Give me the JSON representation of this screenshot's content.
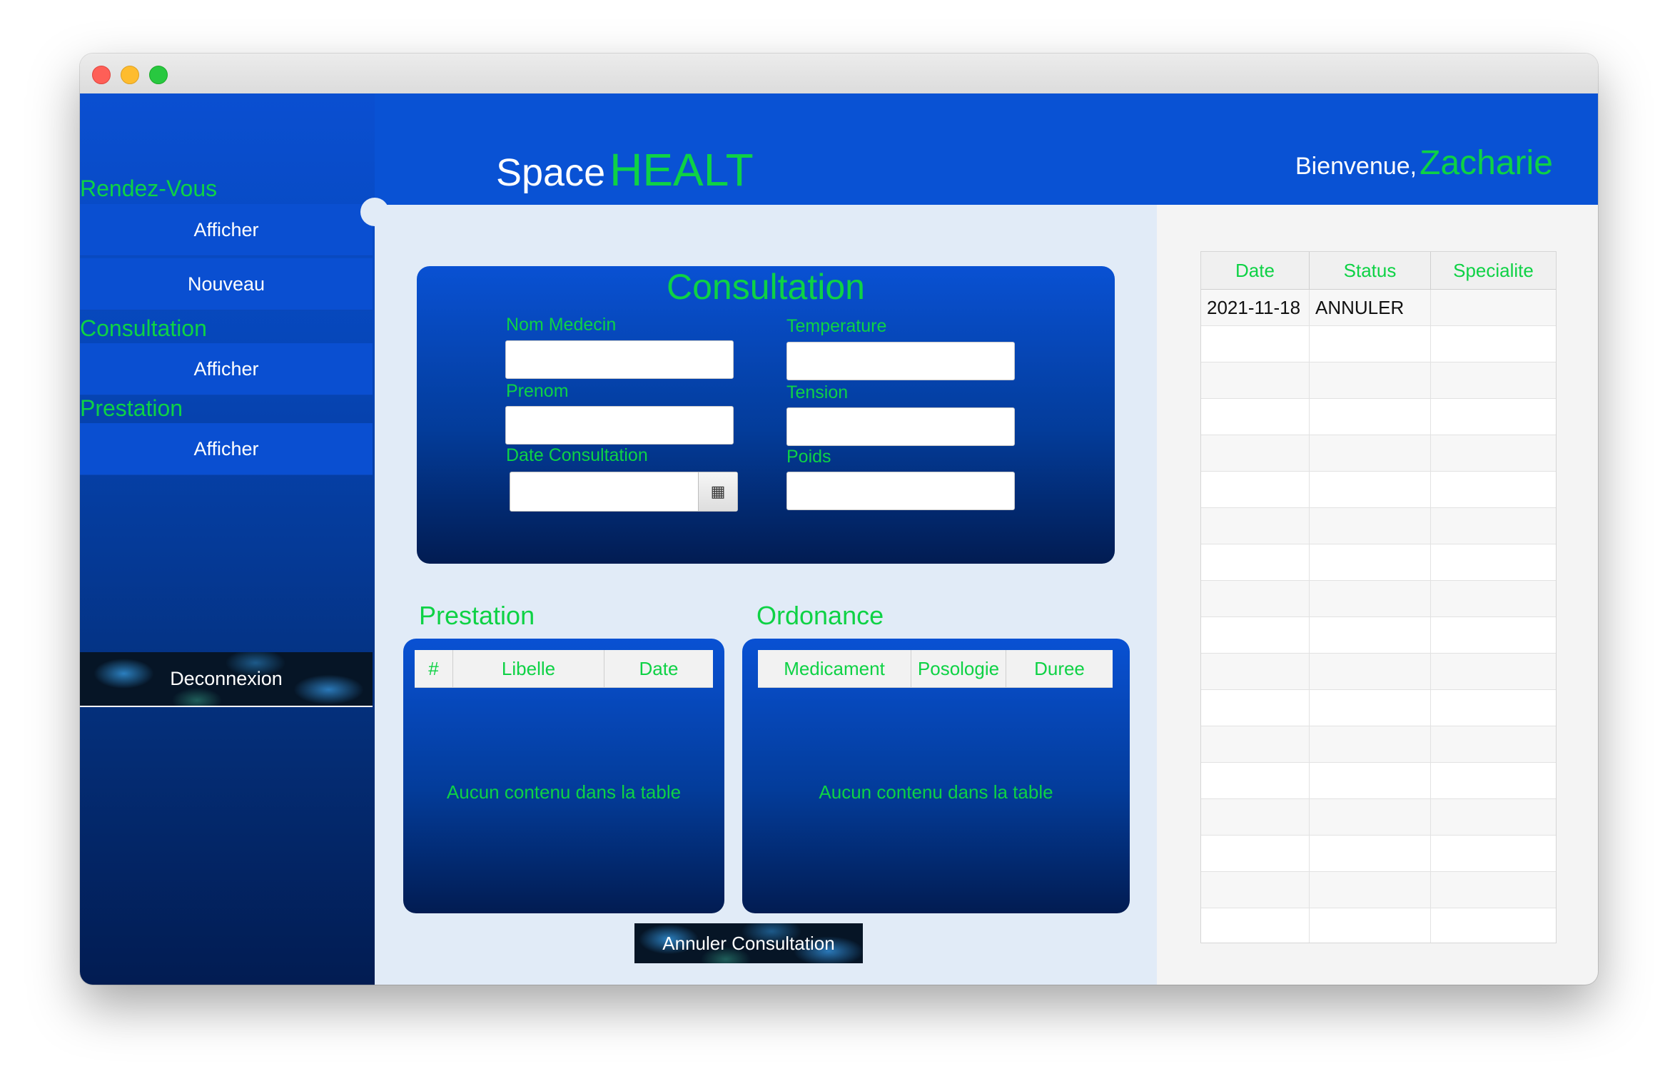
{
  "app": {
    "brand_prefix": "Space",
    "brand_accent": "HEALT",
    "welcome_text": "Bienvenue,",
    "user_name": "Zacharie"
  },
  "sidebar": {
    "rendezvous_label": "Rendez-Vous",
    "rendezvous_afficher": "Afficher",
    "rendezvous_nouveau": "Nouveau",
    "consultation_label": "Consultation",
    "consultation_afficher": "Afficher",
    "prestation_label": "Prestation",
    "prestation_afficher": "Afficher",
    "logout": "Deconnexion"
  },
  "consultation_form": {
    "title": "Consultation",
    "nom_medecin_label": "Nom Medecin",
    "prenom_label": "Prenom",
    "date_label": "Date Consultation",
    "temperature_label": "Temperature",
    "tension_label": "Tension",
    "poids_label": "Poids",
    "date_picker_icon": "calendar-icon"
  },
  "prestation": {
    "title": "Prestation",
    "columns": [
      "#",
      "Libelle",
      "Date"
    ],
    "empty_message": "Aucun contenu dans la table"
  },
  "ordonance": {
    "title": "Ordonance",
    "columns": [
      "Medicament",
      "Posologie",
      "Duree"
    ],
    "empty_message": "Aucun contenu dans la table"
  },
  "cancel_button": "Annuler Consultation",
  "consultations_table": {
    "columns": [
      "Date",
      "Status",
      "Specialite"
    ],
    "rows": [
      [
        "2021-11-18",
        "ANNULER",
        ""
      ]
    ]
  },
  "colors": {
    "accent_green": "#0ed245",
    "primary_blue": "#0952d4",
    "dark_blue": "#021c52"
  }
}
